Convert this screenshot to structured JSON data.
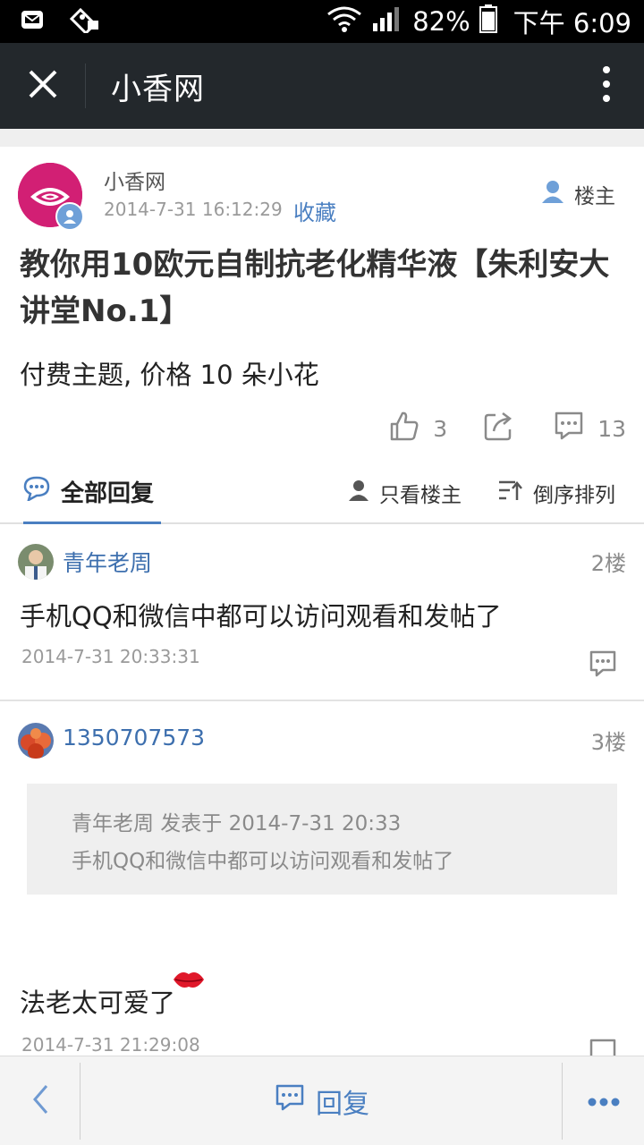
{
  "status_bar": {
    "battery": "82%",
    "time": "下午 6:09",
    "icons": [
      "mail-icon",
      "ticket-icon",
      "wifi-icon",
      "signal-icon",
      "battery-icon"
    ]
  },
  "app_bar": {
    "title": "小香网",
    "close_icon": "close-icon",
    "more_icon": "more-vertical-icon"
  },
  "post": {
    "author": "小香网",
    "time": "2014-7-31 16:12:29",
    "favorite_label": "收藏",
    "owner_label": "楼主",
    "title": "教你用10欧元自制抗老化精华液【朱利安大讲堂No.1】",
    "body": "付费主题, 价格 10 朵小花",
    "likes": "3",
    "comments": "13"
  },
  "tabs": {
    "all_replies": "全部回复",
    "only_owner": "只看楼主",
    "reverse_sort": "倒序排列"
  },
  "replies": [
    {
      "name": "青年老周",
      "floor": "2楼",
      "text": "手机QQ和微信中都可以访问观看和发帖了",
      "time": "2014-7-31 20:33:31"
    },
    {
      "name": "1350707573",
      "floor": "3楼",
      "quote_header": "青年老周 发表于 2014-7-31 20:33",
      "quote_text": "手机QQ和微信中都可以访问观看和发帖了",
      "text": "法老太可爱了",
      "time": "2014-7-31 21:29:08"
    }
  ],
  "bottom_bar": {
    "reply_label": "回复"
  },
  "colors": {
    "accent": "#4a7fc1",
    "app_bar": "#23282c",
    "avatar_brand": "#d21f74"
  }
}
